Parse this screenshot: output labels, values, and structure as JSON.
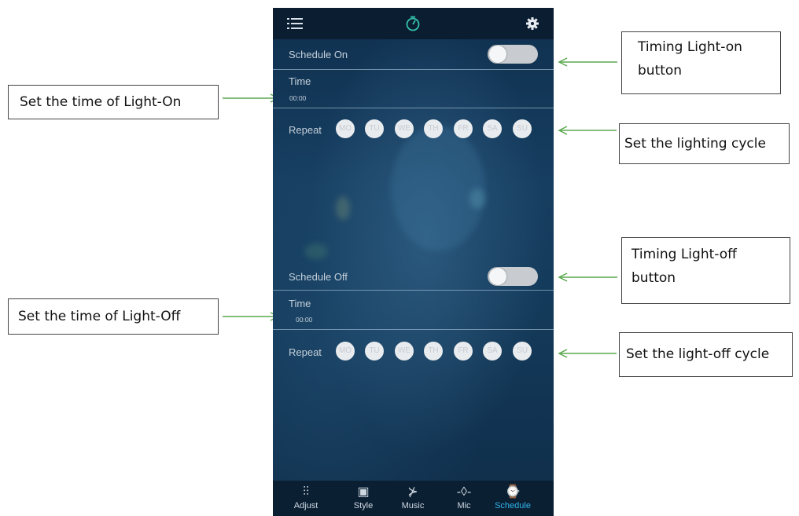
{
  "callouts": {
    "timing_on": "Timing Light-on\nbutton",
    "set_time_on": "Set the time of Light-On",
    "lighting_cycle": "Set the lighting cycle",
    "timing_off": "Timing Light-off\nbutton",
    "set_time_off": "Set the time of Light-Off",
    "off_cycle": "Set the light-off cycle"
  },
  "app": {
    "topbar": {
      "menu_icon": "list-icon",
      "center_icon": "timer-icon",
      "settings_icon": "gear-icon"
    },
    "schedule_on": {
      "label": "Schedule On",
      "enabled": false,
      "time_label": "Time",
      "time_value": "00:00",
      "repeat_label": "Repeat",
      "days": [
        "MO",
        "TU",
        "WE",
        "TH",
        "FR",
        "SA",
        "SU"
      ]
    },
    "schedule_off": {
      "label": "Schedule Off",
      "enabled": false,
      "time_label": "Time",
      "time_value": "00:00",
      "repeat_label": "Repeat",
      "days": [
        "MO",
        "TU",
        "WE",
        "TH",
        "FR",
        "SA",
        "SU"
      ]
    },
    "nav": [
      {
        "label": "Adjust",
        "icon": "sliders-icon",
        "active": false
      },
      {
        "label": "Style",
        "icon": "grid-icon",
        "active": false
      },
      {
        "label": "Music",
        "icon": "music-icon",
        "active": false
      },
      {
        "label": "Mic",
        "icon": "mic-icon",
        "active": false
      },
      {
        "label": "Schedule",
        "icon": "timer-icon",
        "active": true
      }
    ],
    "colors": {
      "accent": "#2fb5e6",
      "callout_arrow": "#5aa84f"
    }
  }
}
